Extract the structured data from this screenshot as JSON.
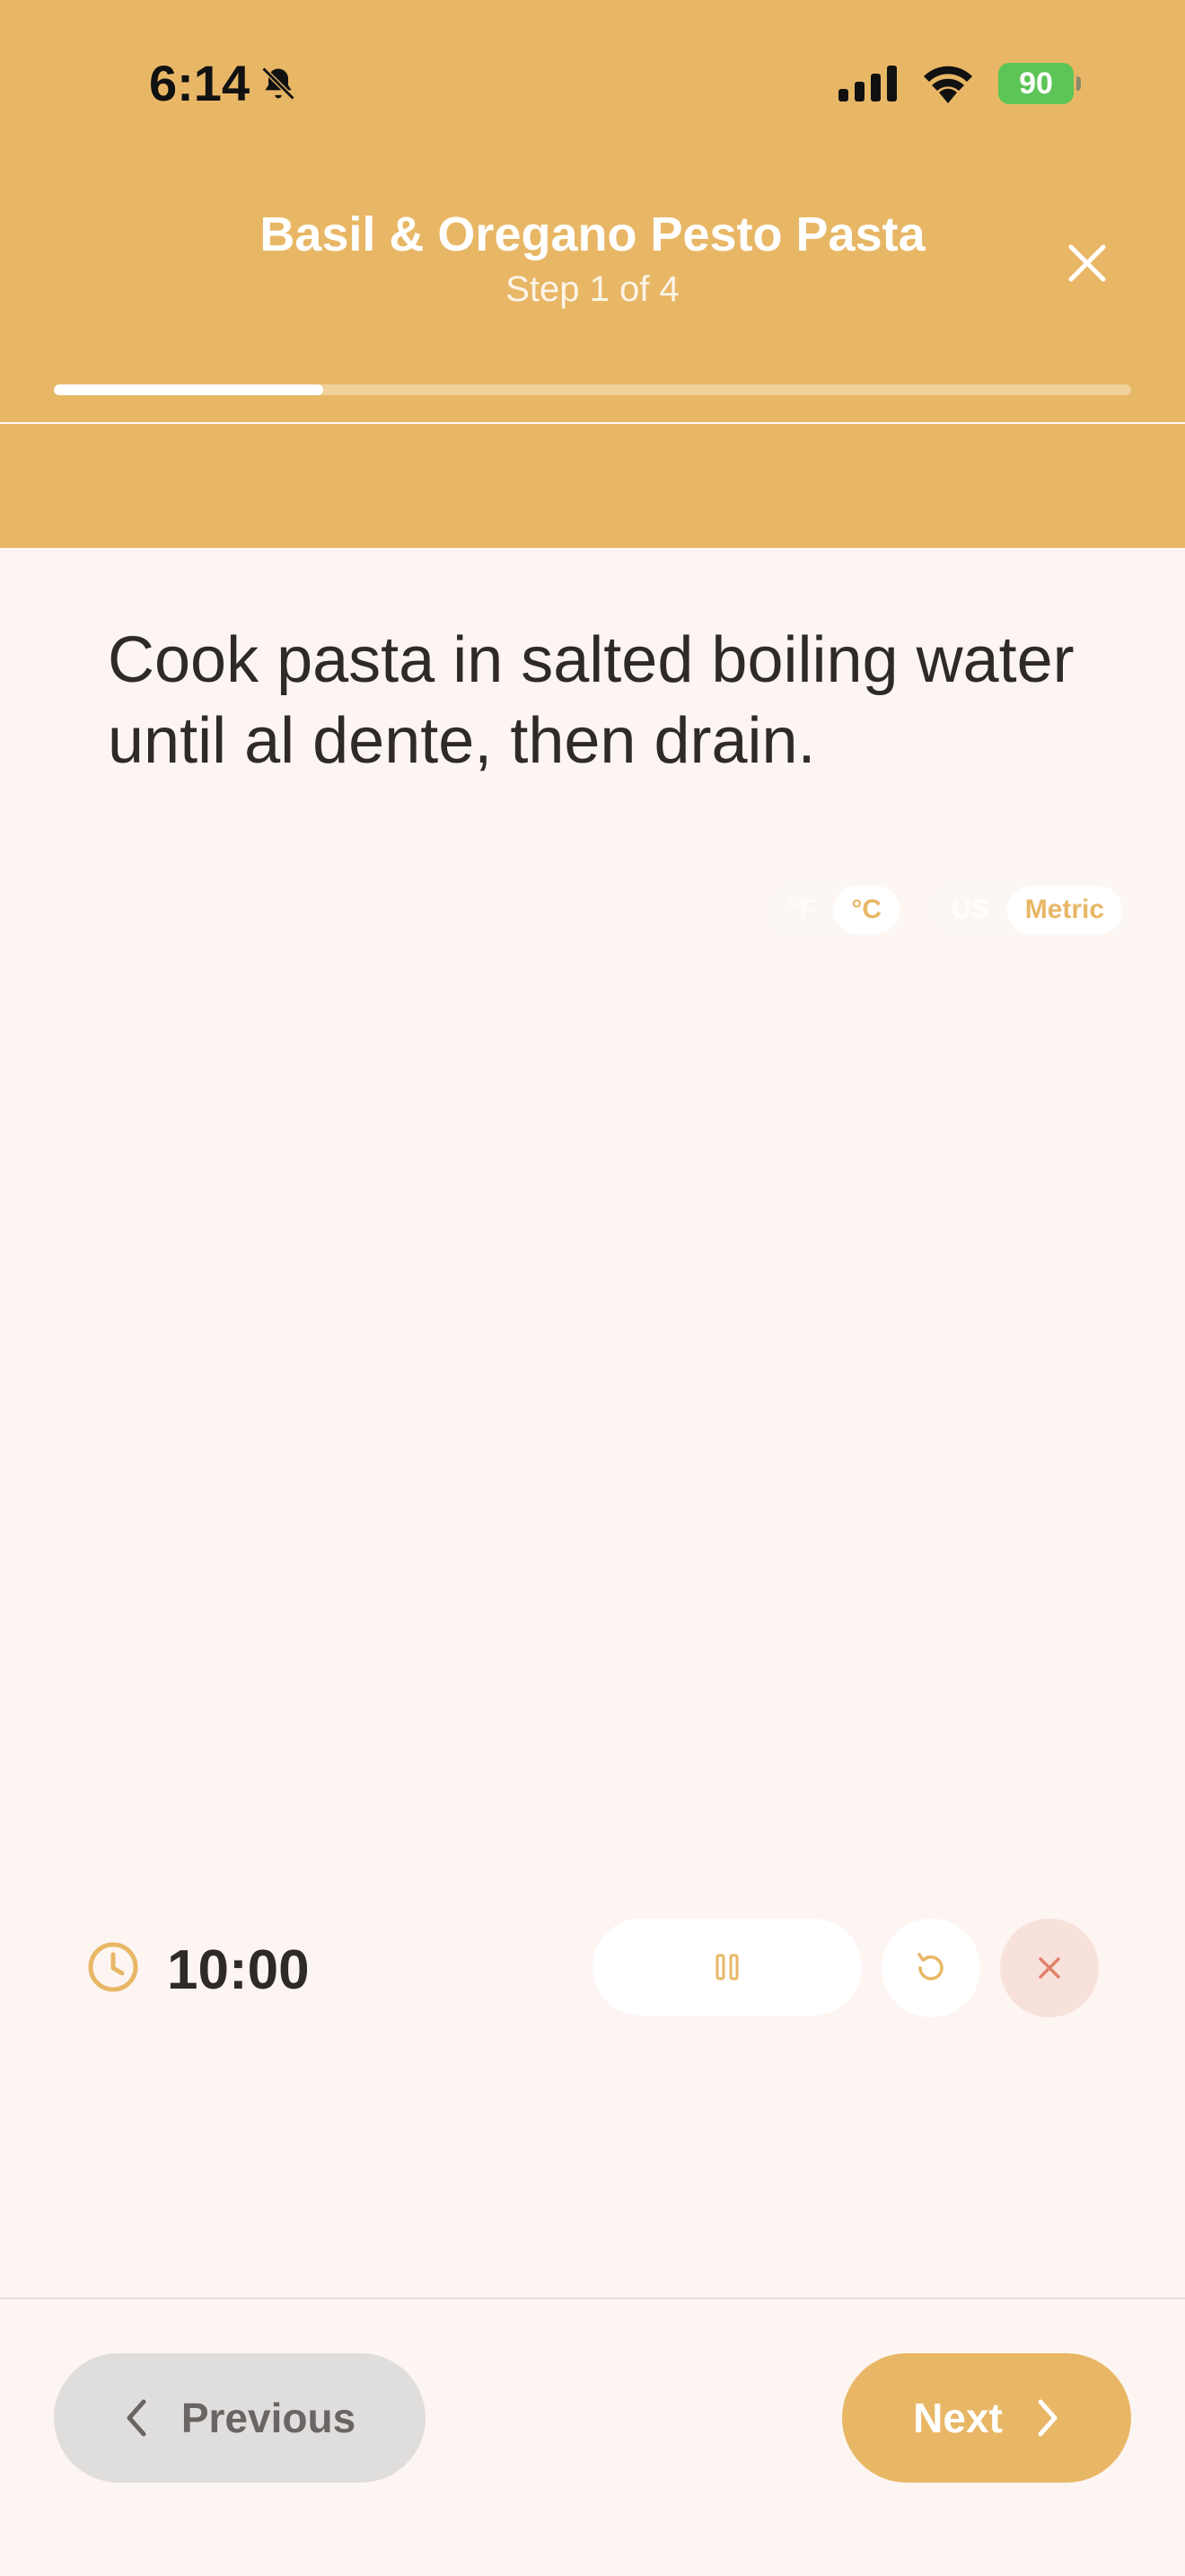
{
  "status_bar": {
    "time": "6:14",
    "battery": "90"
  },
  "header": {
    "title": "Basil & Oregano Pesto Pasta",
    "step_text": "Step 1 of 4",
    "progress": 0.25
  },
  "toggles": {
    "temperature": {
      "options": [
        "°F",
        "°C"
      ],
      "selected": "°C"
    },
    "units": {
      "options": [
        "US",
        "Metric"
      ],
      "selected": "Metric"
    }
  },
  "instruction": "Cook pasta in salted boiling water until al dente, then drain.",
  "timer": {
    "value": "10:00"
  },
  "footer": {
    "previous_label": "Previous",
    "next_label": "Next"
  },
  "colors": {
    "accent": "#E8B766",
    "background": "#FDF5F1",
    "cancel_tint": "#F8E1DA",
    "cancel_icon": "#E0826A"
  },
  "icons": [
    "bell-slash-icon",
    "signal-icon",
    "wifi-icon",
    "battery-icon",
    "close-icon",
    "clock-icon",
    "pause-icon",
    "reset-icon",
    "cancel-icon",
    "chevron-left-icon",
    "chevron-right-icon"
  ]
}
